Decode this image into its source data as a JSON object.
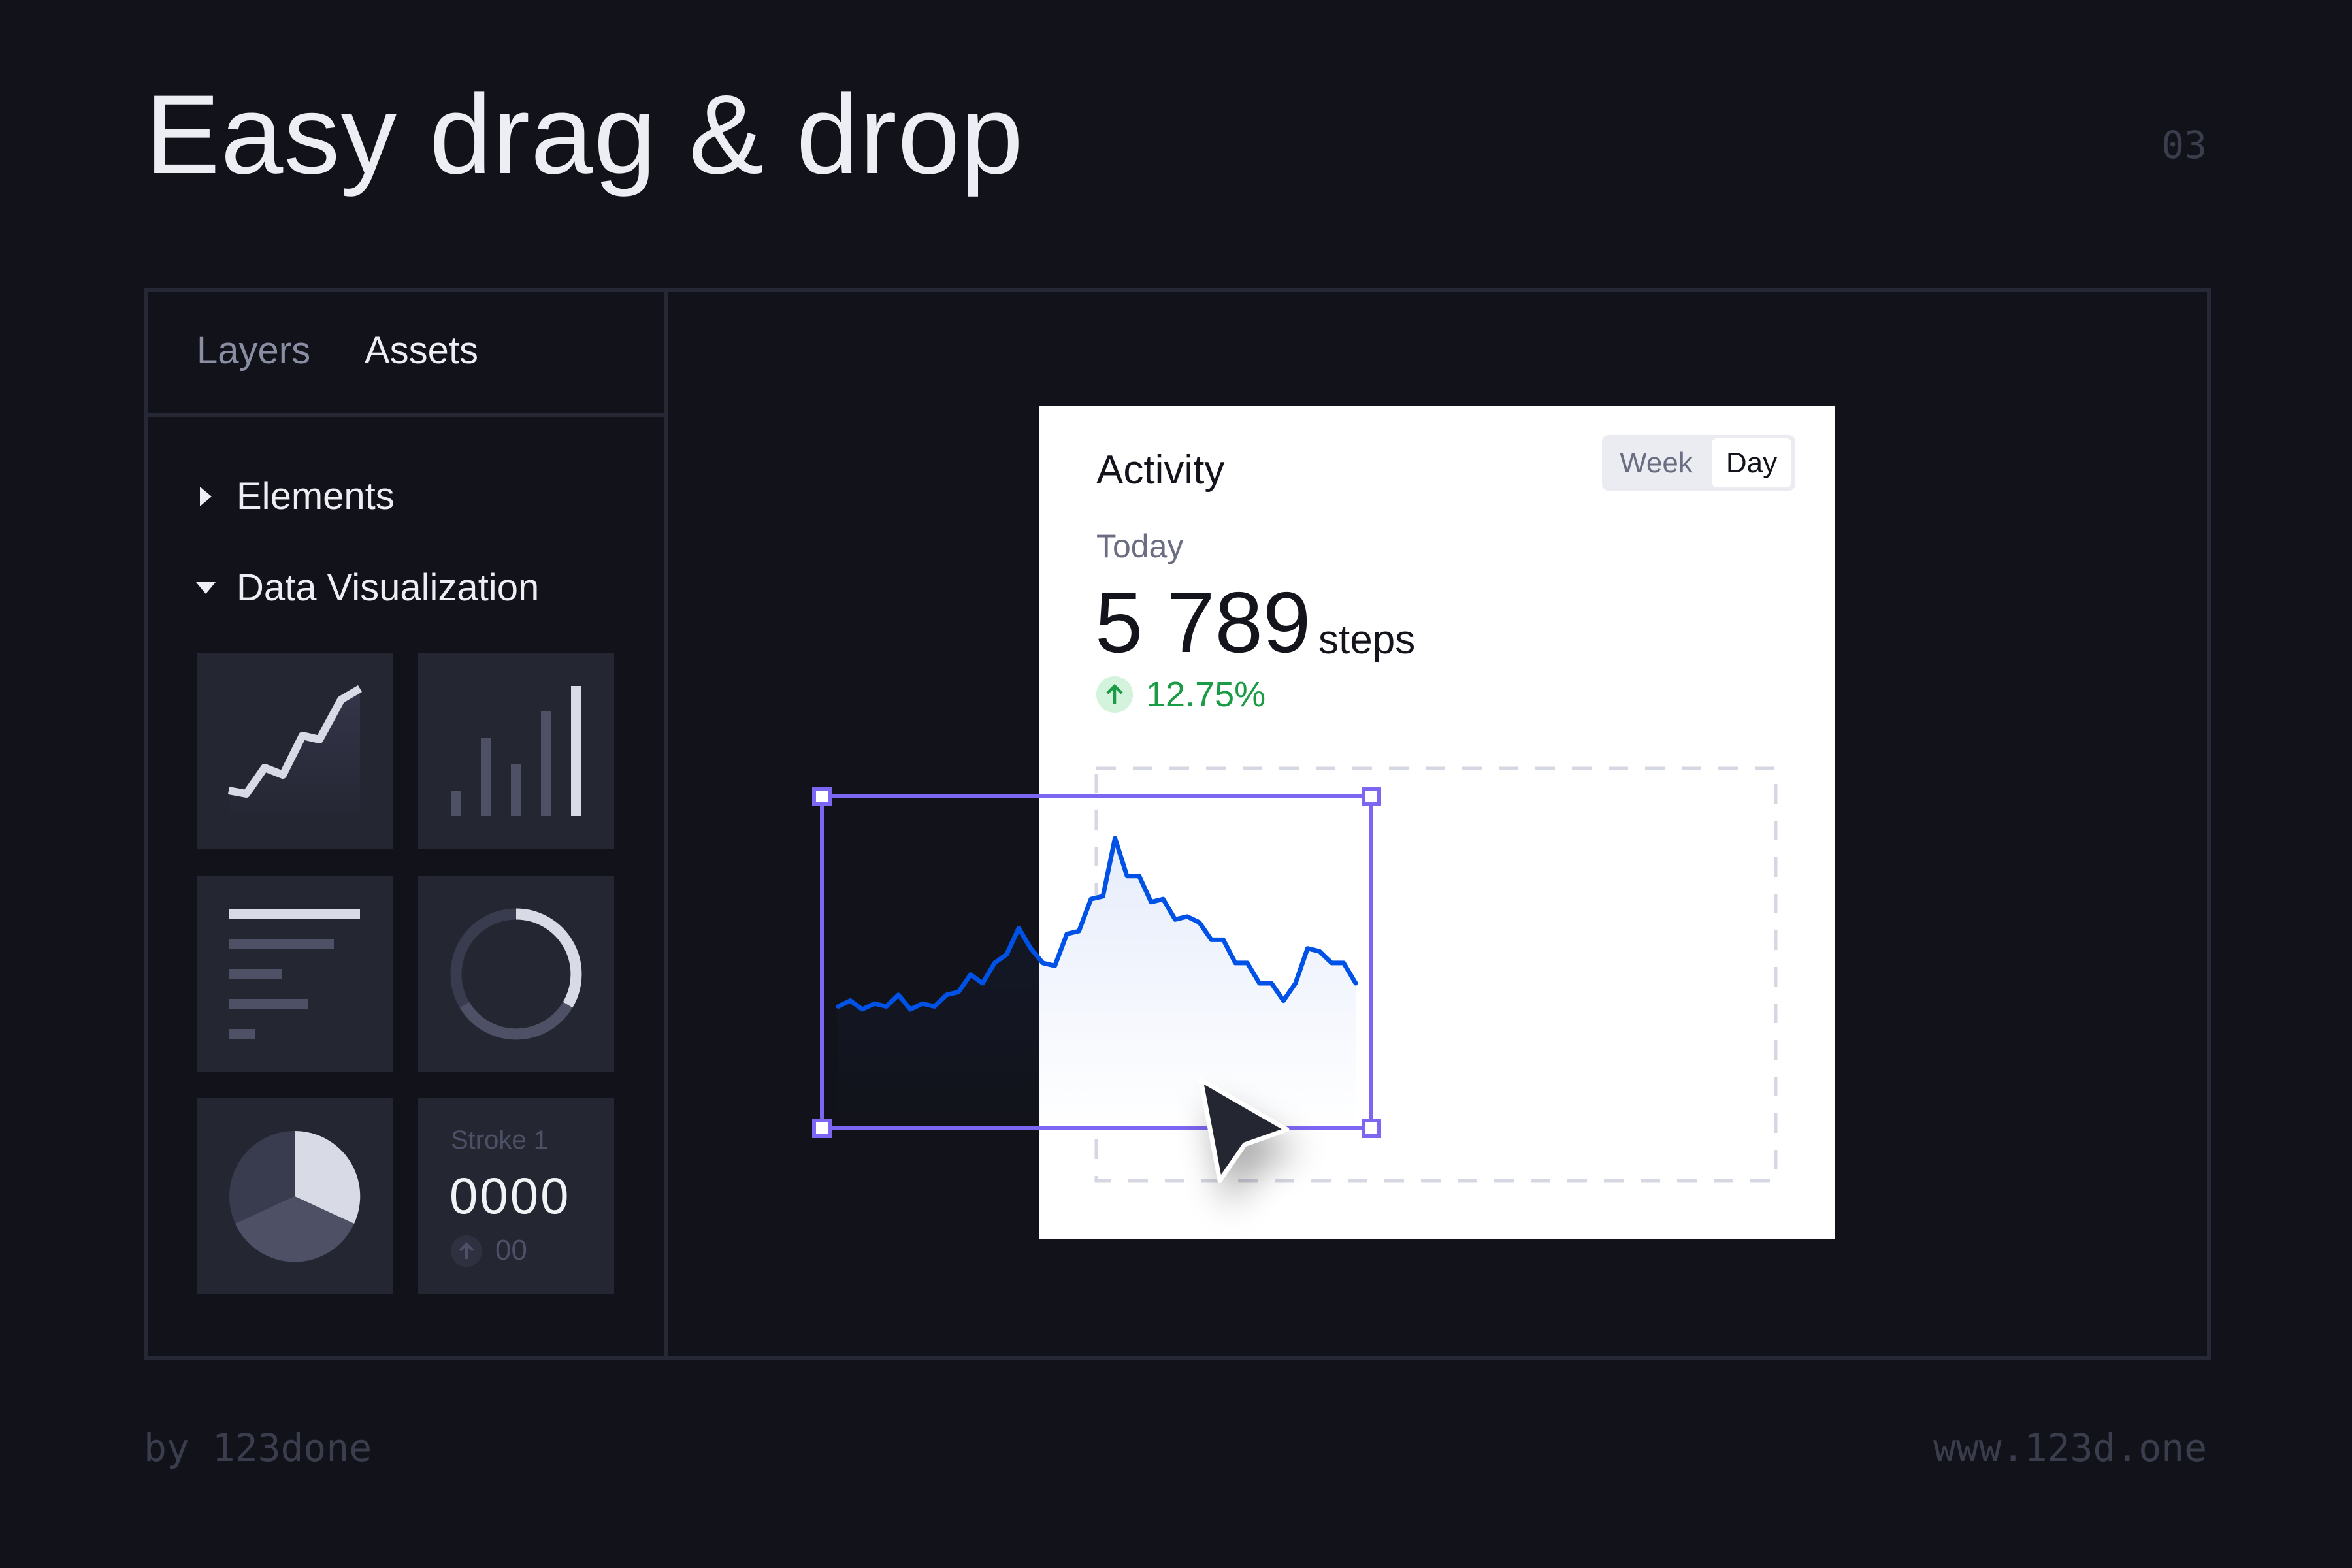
{
  "header": {
    "title": "Easy drag & drop",
    "page_number": "03"
  },
  "sidebar": {
    "tabs": [
      {
        "label": "Layers",
        "active": false
      },
      {
        "label": "Assets",
        "active": true
      }
    ],
    "tree": [
      {
        "label": "Elements",
        "expanded": false
      },
      {
        "label": "Data Visualization",
        "expanded": true
      }
    ],
    "tiles": [
      {
        "type": "line-chart"
      },
      {
        "type": "bar-chart"
      },
      {
        "type": "bar-list"
      },
      {
        "type": "donut"
      },
      {
        "type": "pie"
      },
      {
        "type": "stat",
        "label": "Stroke 1",
        "value": "0000",
        "change": "00"
      }
    ]
  },
  "card": {
    "title": "Activity",
    "toggle": {
      "options": [
        "Week",
        "Day"
      ],
      "selected": "Day"
    },
    "period": "Today",
    "value": "5 789",
    "unit": "steps",
    "change": "12.75%",
    "change_direction": "up"
  },
  "activity_chart": {
    "type": "area",
    "values": [
      42,
      44,
      41,
      43,
      42,
      46,
      41,
      43,
      42,
      46,
      47,
      53,
      50,
      57,
      60,
      69,
      62,
      57,
      56,
      67,
      68,
      79,
      80,
      100,
      87,
      87,
      78,
      79,
      72,
      73,
      71,
      65,
      65,
      57,
      57,
      50,
      50,
      44,
      50,
      62,
      61,
      57,
      57,
      50
    ],
    "line_color": "#0052e6"
  },
  "colors": {
    "background": "#12131a",
    "selection": "#7b67f2",
    "accent_green": "#1a9b45",
    "tile": "#242632"
  },
  "footer": {
    "left": "by 123done",
    "right": "www.123d.one"
  }
}
